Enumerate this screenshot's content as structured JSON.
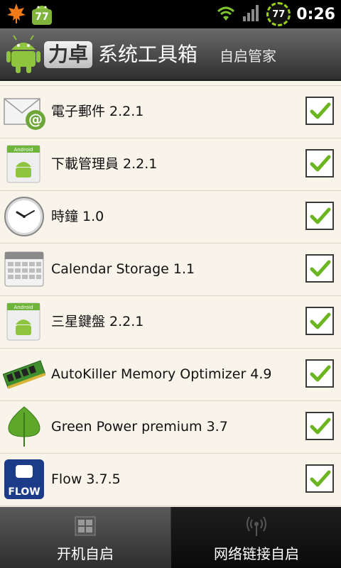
{
  "status_bar": {
    "notification_count": "77",
    "battery_level": "77",
    "time": "0:26"
  },
  "header": {
    "brand": "力卓",
    "title": "系统工具箱",
    "subtitle": "自启管家"
  },
  "apps": [
    {
      "label": "電子郵件 2.2.1",
      "icon": "email-icon",
      "checked": true
    },
    {
      "label": "下載管理員 2.2.1",
      "icon": "android-download-icon",
      "checked": true
    },
    {
      "label": "時鐘 1.0",
      "icon": "clock-icon",
      "checked": true
    },
    {
      "label": "Calendar Storage 1.1",
      "icon": "calendar-icon",
      "checked": true
    },
    {
      "label": "三星鍵盤 2.2.1",
      "icon": "android-keyboard-icon",
      "checked": true
    },
    {
      "label": "AutoKiller Memory Optimizer 4.9",
      "icon": "memory-chip-icon",
      "checked": true
    },
    {
      "label": "Green Power premium 3.7",
      "icon": "leaf-icon",
      "checked": true
    },
    {
      "label": "Flow 3.7.5",
      "icon": "flow-icon",
      "flow_text": "FLOW",
      "checked": true
    }
  ],
  "tabs": [
    {
      "label": "开机自启",
      "active": true
    },
    {
      "label": "网络链接自启",
      "active": false
    }
  ],
  "colors": {
    "check_green": "#6ab520",
    "list_bg": "#f8f4ea",
    "active_tab": "#4a4a4a"
  }
}
